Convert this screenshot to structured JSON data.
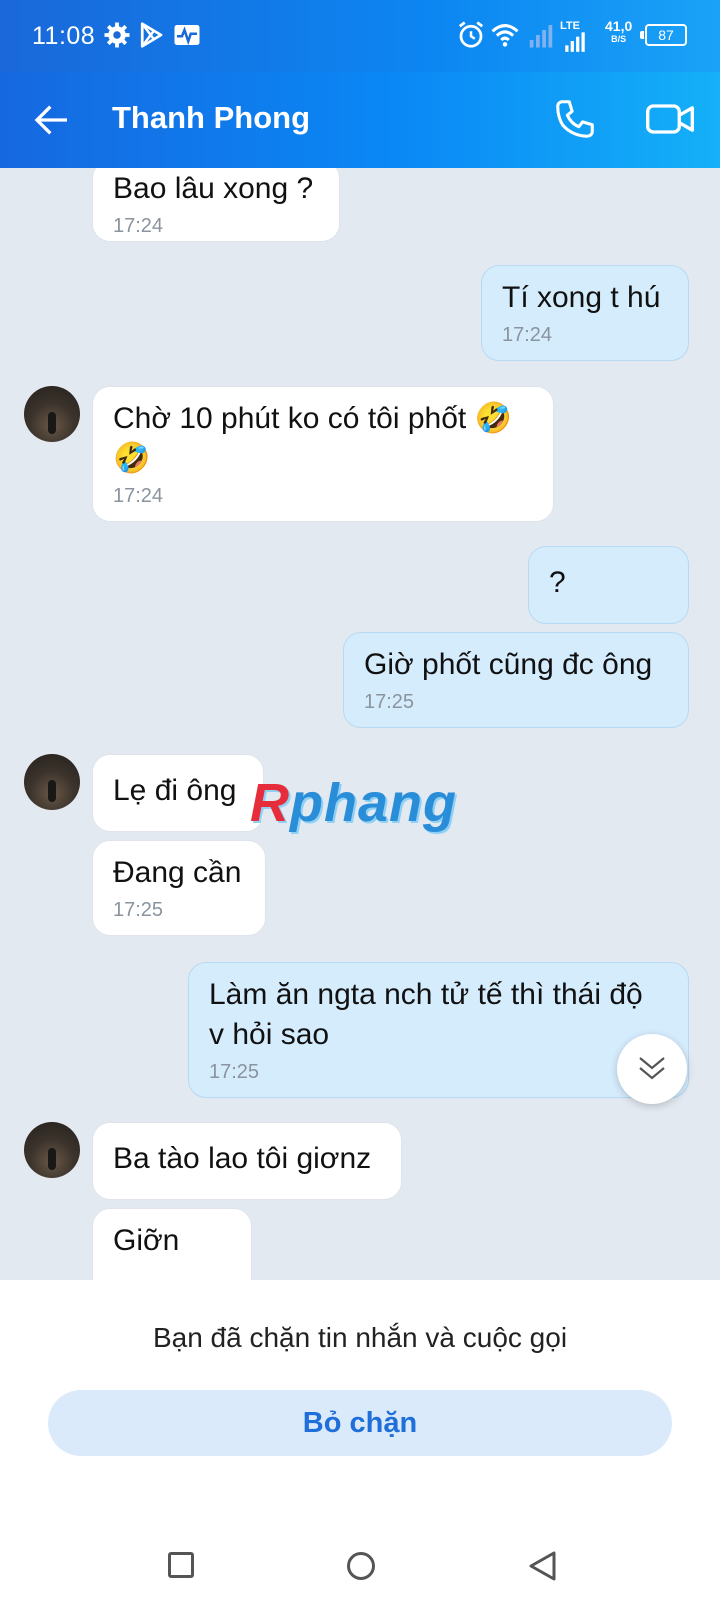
{
  "status_bar": {
    "time": "11:08",
    "network_speed_value": "41,0",
    "network_speed_unit": "B/S",
    "lte_label": "LTE",
    "battery": "87"
  },
  "header": {
    "contact_name": "Thanh Phong"
  },
  "messages": [
    {
      "side": "in",
      "text": "Bao lâu xong ?",
      "time": "17:24"
    },
    {
      "side": "out",
      "text": "Tí xong t hú",
      "time": "17:24"
    },
    {
      "side": "in",
      "text": "Chờ 10 phút ko có tôi phốt 🤣🤣",
      "time": "17:24"
    },
    {
      "side": "out",
      "text": "?",
      "time": ""
    },
    {
      "side": "out",
      "text": "Giờ phốt cũng đc ông",
      "time": "17:25"
    },
    {
      "side": "in",
      "text": "Lẹ đi ông",
      "time": ""
    },
    {
      "side": "in",
      "text": "Đang cần",
      "time": "17:25"
    },
    {
      "side": "out",
      "text": "Làm ăn ngta nch tử tế thì thái độ v hỏi sao",
      "time": "17:25"
    },
    {
      "side": "in",
      "text": "Ba tào lao tôi giơnz",
      "time": ""
    },
    {
      "side": "in",
      "text": "Giỡn",
      "time": ""
    }
  ],
  "watermark": {
    "r": "R",
    "rest": "phang"
  },
  "blocked_panel": {
    "notice": "Bạn đã chặn tin nhắn và cuộc gọi",
    "unblock_label": "Bỏ chặn"
  },
  "colors": {
    "header_start": "#1668e0",
    "header_end": "#14b0f8",
    "outgoing_bubble": "#d5ecfd",
    "incoming_bubble": "#ffffff",
    "chat_background": "#e2e9f1",
    "unblock_text": "#1e6fd9"
  },
  "icons": {
    "back": "arrow-left-icon",
    "call": "phone-icon",
    "video": "video-camera-icon",
    "scroll": "double-chevron-down-icon"
  }
}
